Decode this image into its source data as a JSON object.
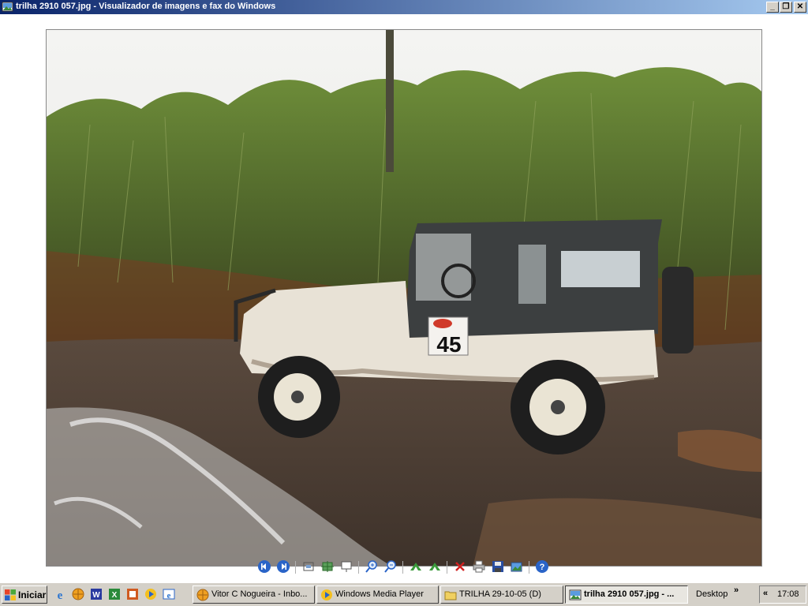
{
  "window": {
    "title": "trilha 2910 057.jpg - Visualizador de imagens e fax do Windows",
    "minimize": "_",
    "restore": "❐",
    "close": "✕"
  },
  "photo": {
    "plate_number": "45"
  },
  "toolbar": {
    "icons": [
      "previous-image-icon",
      "next-image-icon",
      "best-fit-icon",
      "actual-size-icon",
      "slideshow-icon",
      "zoom-in-icon",
      "zoom-out-icon",
      "rotate-clockwise-icon",
      "rotate-counterclockwise-icon",
      "delete-icon",
      "print-icon",
      "save-icon",
      "open-for-editing-icon",
      "help-icon"
    ]
  },
  "taskbar": {
    "start_label": "Iniciar",
    "quicklaunch": [
      "ie-icon",
      "outlook-icon",
      "word-icon",
      "excel-icon",
      "powerpoint-icon",
      "media-player-icon",
      "ie-alt-icon"
    ],
    "tasks": [
      {
        "label": "Vitor C Nogueira - Inbo...",
        "active": false
      },
      {
        "label": "Windows Media Player",
        "active": false
      },
      {
        "label": "TRILHA 29-10-05 (D)",
        "active": false
      },
      {
        "label": "trilha 2910 057.jpg - ...",
        "active": true
      }
    ],
    "desktop_label": "Desktop",
    "desktop_chevron": "»",
    "tray_chevron": "«",
    "clock": "17:08"
  },
  "colors": {
    "titlebar_start": "#0a246a",
    "titlebar_end": "#a6caf0",
    "taskbar": "#d4d0c8"
  }
}
